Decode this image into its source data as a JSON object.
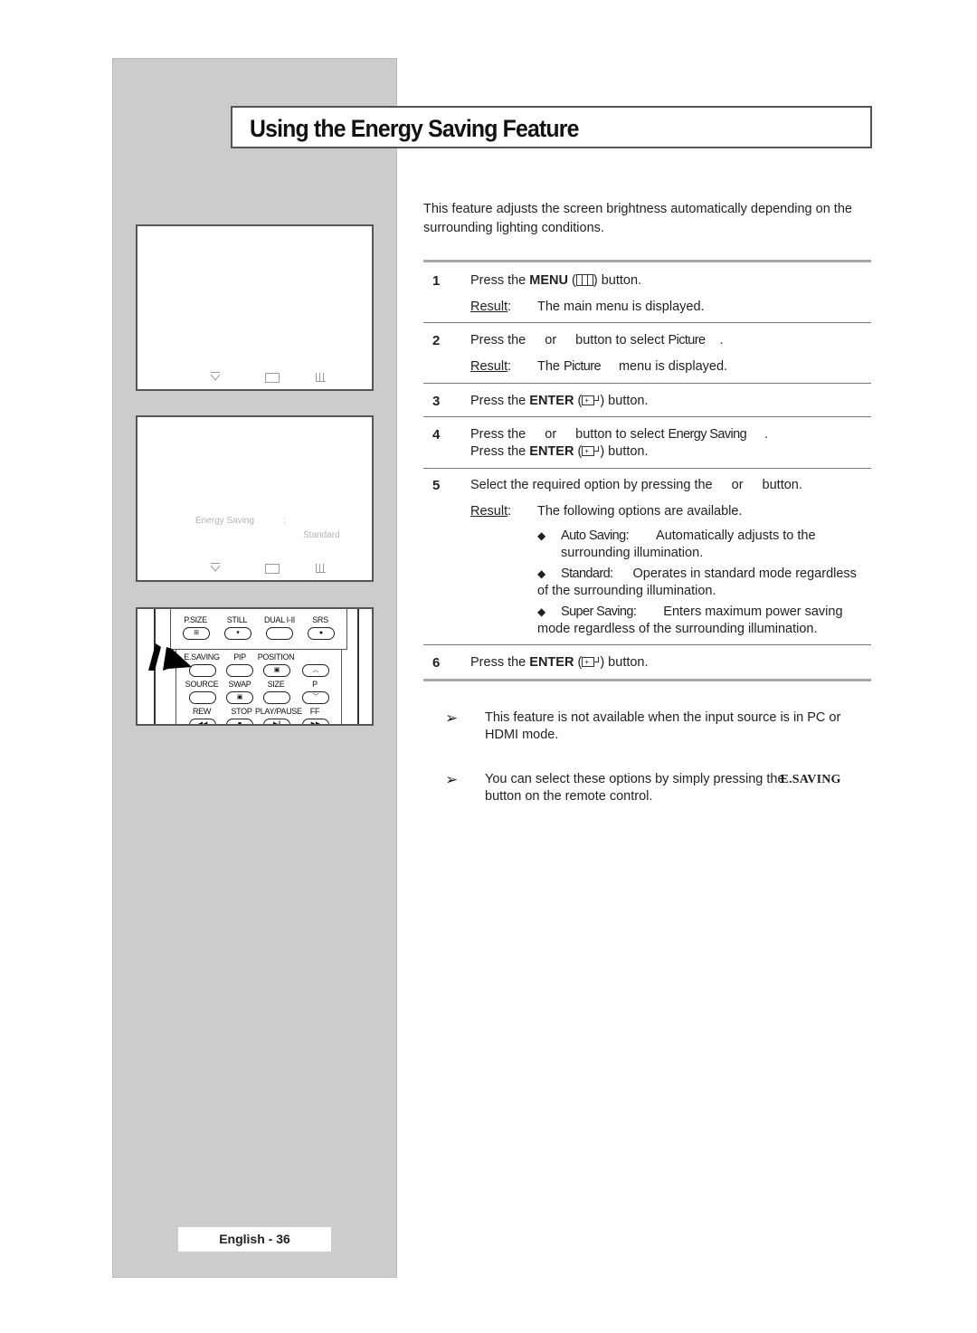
{
  "page": {
    "title": "Using the Energy Saving Feature",
    "intro": "This feature adjusts the screen brightness automatically depending on the surrounding lighting conditions.",
    "intro_line1": "This feature adjusts the screen brightness automatically depending on the",
    "intro_line2": "surrounding lighting conditions.",
    "page_number": "English - 36"
  },
  "osd": {
    "screen1": {
      "icons": [
        "move-icon",
        "enter-icon",
        "menu-icon"
      ]
    },
    "screen2": {
      "label": "Energy Saving",
      "colon": ":",
      "value": "Standard",
      "icons": [
        "move-icon",
        "enter-icon",
        "menu-icon"
      ]
    }
  },
  "remote": {
    "row1": [
      "P.SIZE",
      "STILL",
      "DUAL I-II",
      "SRS"
    ],
    "row2": [
      "E.SAVING",
      "PIP",
      "POSITION"
    ],
    "row3": [
      "SOURCE",
      "SWAP",
      "SIZE",
      "P"
    ],
    "row4": [
      "REW",
      "STOP",
      "PLAY/PAUSE",
      "FF"
    ]
  },
  "steps": [
    {
      "number": "1",
      "text_pre": "Press the ",
      "key": "MENU",
      "text_post": " button.",
      "result_label": "Result",
      "result_text": "The main menu is displayed."
    },
    {
      "number": "2",
      "text_a": "Press the",
      "text_b": "or",
      "text_c": "button to select",
      "menu_item": "Picture",
      "text_end": ".",
      "result_label": "Result",
      "result_pre": "The",
      "result_item": "Picture",
      "result_post": "menu is displayed."
    },
    {
      "number": "3",
      "text_pre": "Press the ",
      "key": "ENTER",
      "text_post": " button."
    },
    {
      "number": "4",
      "text_a": "Press the",
      "text_b": "or",
      "text_c": "button to select",
      "menu_item": "Energy Saving",
      "text_end": ".",
      "line2_pre": "Press the ",
      "line2_key": "ENTER",
      "line2_post": " button."
    },
    {
      "number": "5",
      "text_a": "Select the required option by pressing the",
      "text_b": "or",
      "text_c": "button.",
      "result_label": "Result",
      "result_text": "The following options are available.",
      "options": [
        {
          "name": "Auto Saving:",
          "desc_line1": "Automatically adjusts to the",
          "desc_line2": "surrounding illumination."
        },
        {
          "name": "Standard:",
          "desc_line1": "Operates in standard mode regardless",
          "desc_line2": "of the surrounding illumination."
        },
        {
          "name": "Super Saving:",
          "desc_line1": "Enters maximum power saving",
          "desc_line2": "mode regardless of the surrounding illumination."
        }
      ]
    },
    {
      "number": "6",
      "text_pre": "Press the ",
      "key": "ENTER",
      "text_post": " button."
    }
  ],
  "notes": [
    {
      "line1": "This feature is not available when the input source is in PC or",
      "line2": "HDMI mode."
    },
    {
      "line1": "You can select these options by simply pressing the",
      "button": "E.SAVING",
      "line2": "button on the remote control."
    }
  ],
  "symbols": {
    "bullet": "◆",
    "note_arrow": "➢",
    "open_paren": "(",
    "close_paren": ")"
  }
}
